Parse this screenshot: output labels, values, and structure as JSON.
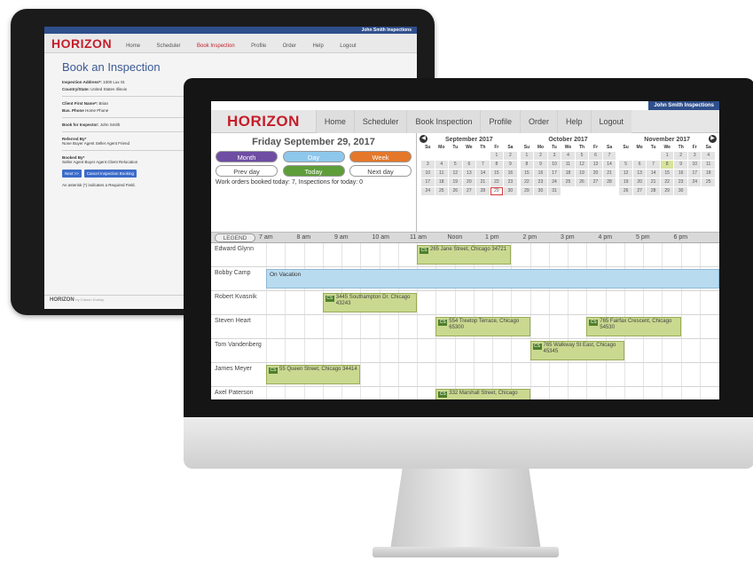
{
  "tablet": {
    "user": "John Smith Inspections",
    "logo": "HORIZON",
    "nav": [
      "Home",
      "Scheduler",
      "Book Inspection",
      "Profile",
      "Order",
      "Help",
      "Logout"
    ],
    "title": "Book an Inspection",
    "rows": [
      {
        "label": "Inspection Address*:",
        "value": "1000 Lux St."
      },
      {
        "label": "Country/State:",
        "value": "United States   Illinois"
      },
      {
        "label": "Client First Name*:",
        "value": "Brian"
      },
      {
        "label": "Bus. Phone",
        "value": "Home Phone"
      },
      {
        "label": "Book for Inspector:",
        "value": "John Smith"
      },
      {
        "label": "Referred By*",
        "value": "None  Buyer Agent  Seller Agent  Friend"
      },
      {
        "label": "Booked By*",
        "value": "Seller Agent  Buyer Agent  Client  Relocation"
      }
    ],
    "next_btn": "Next >>",
    "cancel_btn": "Cancel Inspection Booking",
    "required_note": "An asterisk (*) indicates a Required Field.",
    "footer_logo": "HORIZON",
    "footer_small": "by Carson Dunlop"
  },
  "app": {
    "user": "John Smith Inspections",
    "logo": "HORIZON",
    "nav": [
      "Home",
      "Scheduler",
      "Book Inspection",
      "Profile",
      "Order",
      "Help",
      "Logout"
    ]
  },
  "day_panel": {
    "title": "Friday September 29, 2017",
    "buttons": {
      "month": "Month",
      "day": "Day",
      "week": "Week",
      "prev": "Prev day",
      "today": "Today",
      "next": "Next day"
    },
    "summary": "Work orders booked today: 7, Inspections for today: 0"
  },
  "calendars": [
    {
      "name": "September 2017",
      "dow": [
        "Su",
        "Mo",
        "Tu",
        "We",
        "Th",
        "Fr",
        "Sa"
      ],
      "days": [
        "",
        "",
        "",
        "",
        "",
        "1",
        "2",
        "3",
        "4",
        "5",
        "6",
        "7",
        "8",
        "9",
        "10",
        "11",
        "12",
        "13",
        "14",
        "15",
        "16",
        "17",
        "18",
        "19",
        "20",
        "21",
        "22",
        "23",
        "24",
        "25",
        "26",
        "27",
        "28",
        "29",
        "30"
      ],
      "today": "29"
    },
    {
      "name": "October 2017",
      "dow": [
        "Su",
        "Mo",
        "Tu",
        "We",
        "Th",
        "Fr",
        "Sa"
      ],
      "days": [
        "1",
        "2",
        "3",
        "4",
        "5",
        "6",
        "7",
        "8",
        "9",
        "10",
        "11",
        "12",
        "13",
        "14",
        "15",
        "16",
        "17",
        "18",
        "19",
        "20",
        "21",
        "22",
        "23",
        "24",
        "25",
        "26",
        "27",
        "28",
        "29",
        "30",
        "31"
      ],
      "today": ""
    },
    {
      "name": "November 2017",
      "dow": [
        "Su",
        "Mo",
        "Tu",
        "We",
        "Th",
        "Fr",
        "Sa"
      ],
      "days": [
        "",
        "",
        "",
        "1",
        "2",
        "3",
        "4",
        "5",
        "6",
        "7",
        "8",
        "9",
        "10",
        "11",
        "12",
        "13",
        "14",
        "15",
        "16",
        "17",
        "18",
        "19",
        "20",
        "21",
        "22",
        "23",
        "24",
        "25",
        "26",
        "27",
        "28",
        "29",
        "30"
      ],
      "today": "",
      "highlight": "8"
    }
  ],
  "timeline": {
    "legend": "LEGEND",
    "hours": [
      "7 am",
      "8 am",
      "9 am",
      "10 am",
      "11 am",
      "Noon",
      "1 pm",
      "2 pm",
      "3 pm",
      "4 pm",
      "5 pm",
      "6 pm"
    ]
  },
  "schedule": [
    {
      "name": "Edward Glynn",
      "appts": [
        {
          "start": 11.0,
          "end": 13.5,
          "tag": "CS",
          "text": "265 Jane Street, Chicago 34721"
        }
      ]
    },
    {
      "name": "Bobby Camp",
      "vacation": "On Vacation"
    },
    {
      "name": "Robert Kvasnik",
      "appts": [
        {
          "start": 8.5,
          "end": 11.0,
          "tag": "CS",
          "text": "3445 Southampton Dr. Chicago 43243"
        }
      ]
    },
    {
      "name": "Steven Heart",
      "appts": [
        {
          "start": 11.5,
          "end": 14.0,
          "tag": "CS",
          "text": "554 Treetop Terrace, Chicago 65300"
        },
        {
          "start": 15.5,
          "end": 18.0,
          "tag": "CS",
          "text": "765 Fairfax Crescent, Chicago 54530"
        }
      ]
    },
    {
      "name": "Tom Vandenberg",
      "appts": [
        {
          "start": 14.0,
          "end": 16.5,
          "tag": "CS",
          "text": "765 Walkway St East, Chicago 45345"
        }
      ]
    },
    {
      "name": "James Meyer",
      "appts": [
        {
          "start": 7.0,
          "end": 9.5,
          "tag": "CS",
          "text": "55 Queen Street, Chicago 34414"
        }
      ]
    },
    {
      "name": "Axel Paterson",
      "appts": [
        {
          "start": 11.5,
          "end": 14.0,
          "tag": "CS",
          "text": "332 Marshall Street, Chicago"
        }
      ]
    }
  ]
}
